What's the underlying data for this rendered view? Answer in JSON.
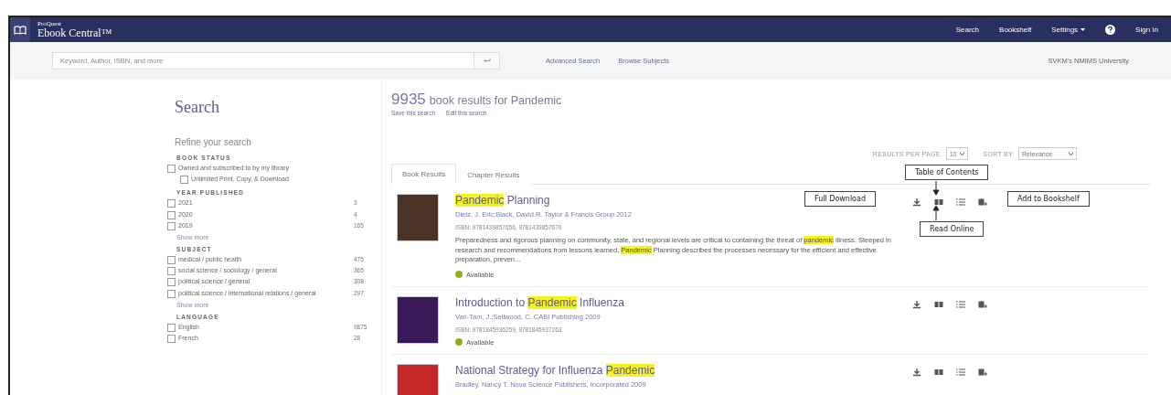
{
  "header": {
    "brand_small": "ProQuest",
    "brand": "Ebook Central™",
    "nav": [
      {
        "label": "Search",
        "kind": "link"
      },
      {
        "label": "Bookshelf",
        "kind": "link"
      },
      {
        "label": "Settings",
        "kind": "menu"
      },
      {
        "kind": "help"
      },
      {
        "label": "Sign In",
        "kind": "link"
      }
    ]
  },
  "searchbar": {
    "placeholder": "Keyword, Author, ISBN, and more",
    "links": [
      "Advanced Search",
      "Browse Subjects"
    ],
    "institution": "SVKM's NMIMS University"
  },
  "sidebar": {
    "title": "Search",
    "subtitle": "Refine your search",
    "groups": [
      {
        "heading": "BOOK STATUS",
        "options": [
          {
            "label": "Owned and subscribed to by my library",
            "checked": false,
            "children": [
              {
                "label": "Unlimited Print, Copy, & Download",
                "checked": false
              }
            ]
          }
        ]
      },
      {
        "heading": "YEAR PUBLISHED",
        "options": [
          {
            "label": "2021",
            "count": "3",
            "checked": false
          },
          {
            "label": "2020",
            "count": "4",
            "checked": false
          },
          {
            "label": "2019",
            "count": "165",
            "checked": false
          }
        ],
        "show_more": "Show more"
      },
      {
        "heading": "SUBJECT",
        "options": [
          {
            "label": "medical / public health",
            "count": "475",
            "checked": false
          },
          {
            "label": "social science / sociology / general",
            "count": "365",
            "checked": false
          },
          {
            "label": "political science / general",
            "count": "308",
            "checked": false
          },
          {
            "label": "political science / international relations / general",
            "count": "297",
            "checked": false
          }
        ],
        "show_more": "Show more"
      },
      {
        "heading": "LANGUAGE",
        "options": [
          {
            "label": "English",
            "count": "9875",
            "checked": false
          },
          {
            "label": "French",
            "count": "28",
            "checked": false
          }
        ]
      }
    ]
  },
  "results": {
    "count": "9935",
    "summary": "book results for Pandemic",
    "links": [
      "Save this search",
      "Edit this search"
    ],
    "per_page_label": "RESULTS PER PAGE",
    "per_page": "10",
    "sort_label": "SORT BY",
    "sort": "Relevance",
    "tabs": [
      {
        "label": "Book Results",
        "selected": true
      },
      {
        "label": "Chapter Results",
        "selected": false
      }
    ],
    "books": [
      {
        "title": "**Pandemic** Planning",
        "authors": "Dietz, J. Eric;Black, David R.  Taylor & Francis Group  2012",
        "isbn": "ISBN: 9781439857656, 9781439857670",
        "description": "Preparedness and rigorous planning on community, state, and regional levels are critical to containing the threat of **pandemic** illness. Steeped in research and recommendations from lessons learned, **Pandemic** Planning describes the processes necessary for the efficient and effective preparation, preven...",
        "status": "Available"
      },
      {
        "title": "Introduction to **Pandemic** Influenza",
        "authors": "Van-Tam, J.;Sellwood, C.  CABI Publishing  2009",
        "isbn": "ISBN: 9781845936259, 9781845937263",
        "status": "Available"
      },
      {
        "title": "National Strategy for Influenza **Pandemic**",
        "authors": "Bradley, Nancy T.  Nova Science Publishers, Incorporated  2009"
      }
    ]
  },
  "callouts": [
    {
      "label": "Table of Contents",
      "kind": "above"
    },
    {
      "label": "Full Download",
      "kind": "left"
    },
    {
      "label": "Add to Bookshelf",
      "kind": "right"
    },
    {
      "label": "Read Online",
      "kind": "below"
    }
  ]
}
